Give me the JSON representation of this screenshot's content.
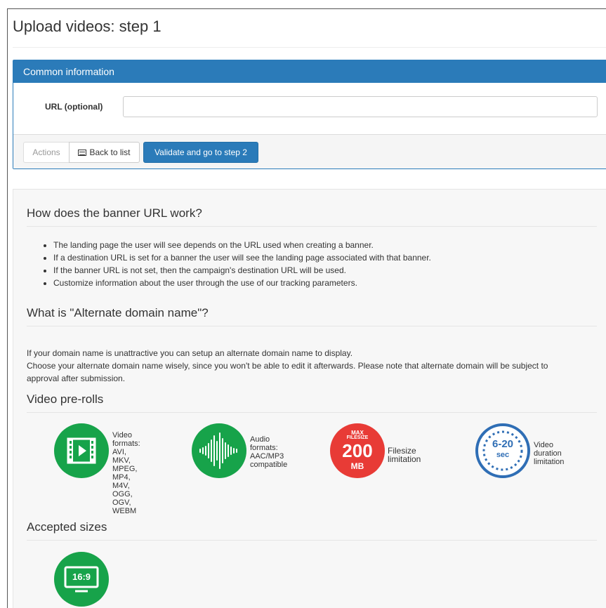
{
  "page": {
    "title": "Upload videos: step 1"
  },
  "panel": {
    "header": "Common information",
    "url_label": "URL (optional)",
    "url_value": "",
    "url_placeholder": "",
    "actions_label": "Actions",
    "back_label": "Back to list",
    "validate_label": "Validate and go to step 2"
  },
  "info": {
    "banner_heading": "How does the banner URL work?",
    "banner_bullets": [
      "The landing page the user will see depends on the URL used when creating a banner.",
      "If a destination URL is set for a banner the user will see the landing page associated with that banner.",
      "If the banner URL is not set, then the campaign's destination URL will be used.",
      "Customize information about the user through the use of our tracking parameters."
    ],
    "alt_heading": "What is \"Alternate domain name\"?",
    "alt_lines": [
      "If your domain name is unattractive you can setup an alternate domain name to display.",
      "Choose your alternate domain name wisely, since you won't be able to edit it afterwards. Please note that alternate domain will be subject to",
      "approval after submission."
    ],
    "preroll_heading": "Video pre-rolls",
    "features": [
      {
        "icon": "video-formats-icon",
        "lines": [
          "Video formats:",
          "AVI, MKV, MPEG,",
          "MP4, M4V, OGG,",
          "OGV, WEBM"
        ]
      },
      {
        "icon": "audio-waveform-icon",
        "lines": [
          "Audio formats:",
          "AAC/MP3",
          "compatible"
        ]
      },
      {
        "icon": "filesize-badge-icon",
        "badge_top": "MAX",
        "badge_mid": "FILESIZE",
        "badge_value": "200",
        "badge_unit": "MB",
        "lines": [
          "Filesize limitation"
        ]
      },
      {
        "icon": "duration-badge-icon",
        "badge_value": "6-20",
        "badge_unit": "sec",
        "lines": [
          "Video duration",
          "limitation"
        ]
      }
    ],
    "sizes_heading": "Accepted sizes",
    "sizes": [
      {
        "icon": "aspect-ratio-monitor-icon",
        "label": "16:9"
      }
    ],
    "colors": {
      "accent": "#2b7bb9",
      "green": "#17a34a",
      "red": "#e83b36",
      "blue": "#2f6eb5"
    }
  }
}
